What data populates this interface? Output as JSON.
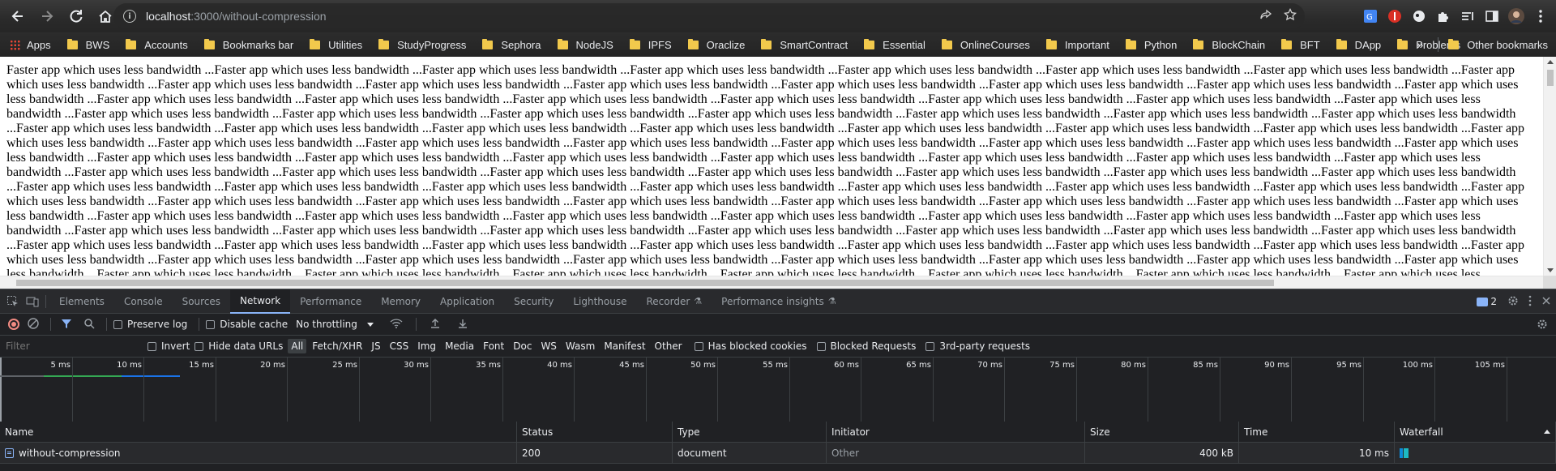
{
  "browser": {
    "url_host": "localhost",
    "url_path": ":3000/without-compression",
    "bookmarks": [
      "Apps",
      "BWS",
      "Accounts",
      "Bookmarks bar",
      "Utilities",
      "StudyProgress",
      "Sephora",
      "NodeJS",
      "IPFS",
      "Oraclize",
      "SmartContract",
      "Essential",
      "OnlineCourses",
      "Important",
      "Python",
      "BlockChain",
      "BFT",
      "DApp",
      "Problems"
    ],
    "overflow_chevron": "»",
    "other_bookmarks": "Other bookmarks",
    "colors": {
      "folder": "#f2c94c"
    }
  },
  "page": {
    "repeated_text": "Faster app which uses less bandwidth ...",
    "background": "#ffffff"
  },
  "devtools": {
    "tabs": [
      "Elements",
      "Console",
      "Sources",
      "Network",
      "Performance",
      "Memory",
      "Application",
      "Security",
      "Lighthouse",
      "Recorder",
      "Performance insights"
    ],
    "active_tab": "Network",
    "issues_count": "2",
    "toolbar": {
      "preserve_log": "Preserve log",
      "disable_cache": "Disable cache",
      "throttling": "No throttling"
    },
    "filter": {
      "placeholder": "Filter",
      "invert": "Invert",
      "hide_data_urls": "Hide data URLs",
      "types": [
        "All",
        "Fetch/XHR",
        "JS",
        "CSS",
        "Img",
        "Media",
        "Font",
        "Doc",
        "WS",
        "Wasm",
        "Manifest",
        "Other"
      ],
      "has_blocked_cookies": "Has blocked cookies",
      "blocked_requests": "Blocked Requests",
      "third_party": "3rd-party requests"
    },
    "timeline_ticks": [
      "5 ms",
      "10 ms",
      "15 ms",
      "20 ms",
      "25 ms",
      "30 ms",
      "35 ms",
      "40 ms",
      "45 ms",
      "50 ms",
      "55 ms",
      "60 ms",
      "65 ms",
      "70 ms",
      "75 ms",
      "80 ms",
      "85 ms",
      "90 ms",
      "95 ms",
      "100 ms",
      "105 ms"
    ],
    "columns": [
      "Name",
      "Status",
      "Type",
      "Initiator",
      "Size",
      "Time",
      "Waterfall"
    ],
    "rows": [
      {
        "name": "without-compression",
        "status": "200",
        "type": "document",
        "initiator": "Other",
        "size": "400 kB",
        "time": "10 ms"
      }
    ],
    "colors": {
      "accent": "#8ab4f8",
      "record": "#f28b82",
      "waterfall_wait": "#0d8bd9",
      "waterfall_download": "#1db9c3"
    }
  }
}
